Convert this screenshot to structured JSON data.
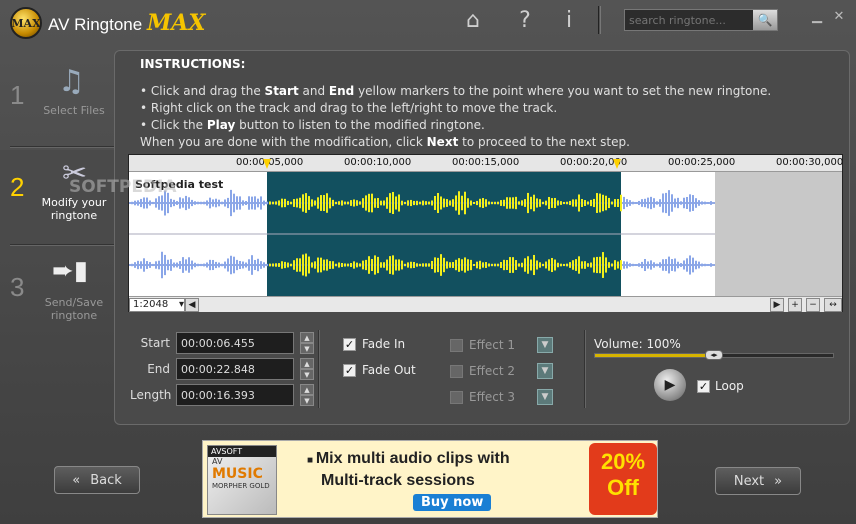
{
  "app": {
    "name": "AV Ringtone",
    "name_suffix": "MAX",
    "logo_text": "MAX"
  },
  "header": {
    "search_placeholder": "search ringtone...",
    "icons": [
      "home-icon",
      "help-icon",
      "info-icon",
      "search-icon"
    ],
    "window": [
      "minimize",
      "close"
    ]
  },
  "steps": [
    {
      "num": "1",
      "label": "Select Files",
      "icon": "music-note-icon",
      "active": false
    },
    {
      "num": "2",
      "label": "Modify your ringtone",
      "icon": "scissors-icon",
      "active": true
    },
    {
      "num": "3",
      "label": "Send/Save ringtone",
      "icon": "phone-icon",
      "active": false
    }
  ],
  "instructions": {
    "title": "INSTRUCTIONS:",
    "l1a": "• Click and drag the ",
    "l1b": "Start",
    "l1c": " and ",
    "l1d": "End",
    "l1e": " yellow markers to the point where you want to set the new ringtone.",
    "l2": "• Right click on the track and drag to the left/right to move the track.",
    "l3a": "• Click the ",
    "l3b": "Play",
    "l3c": " button to listen to the modified ringtone.",
    "l4a": "When you are done with the modification, click ",
    "l4b": "Next",
    "l4c": " to proceed to the next step."
  },
  "track": {
    "name": "Softpedia test",
    "ruler": [
      "00:00:05,000",
      "00:00:10,000",
      "00:00:15,000",
      "00:00:20,000",
      "00:00:25,000",
      "00:00:30,000"
    ],
    "zoom": "1:2048",
    "selection_start_s": 6.455,
    "selection_end_s": 22.848,
    "track_end_s": 27.0,
    "ruler_max_s": 32.0
  },
  "fields": {
    "start_label": "Start",
    "start": "00:00:06.455",
    "end_label": "End",
    "end": "00:00:22.848",
    "length_label": "Length",
    "length": "00:00:16.393"
  },
  "effects": {
    "fade_in": {
      "label": "Fade In",
      "checked": true
    },
    "fade_out": {
      "label": "Fade Out",
      "checked": true
    },
    "effect1": {
      "label": "Effect 1",
      "checked": false
    },
    "effect2": {
      "label": "Effect 2",
      "checked": false
    },
    "effect3": {
      "label": "Effect 3",
      "checked": false
    }
  },
  "volume": {
    "label": "Volume: 100%",
    "level": 1.0
  },
  "loop": {
    "label": "Loop",
    "checked": true
  },
  "nav": {
    "back": "Back",
    "next": "Next"
  },
  "ad": {
    "brand": "AVSOFT",
    "product": "MUSIC",
    "product_prefix": "AV",
    "product_sub": "MORPHER GOLD",
    "line1": "Mix multi audio clips with",
    "line2": "Multi-track sessions",
    "cta": "Buy now",
    "badge1": "20%",
    "badge2": "Off"
  },
  "watermark": "SOFTPEDIA"
}
